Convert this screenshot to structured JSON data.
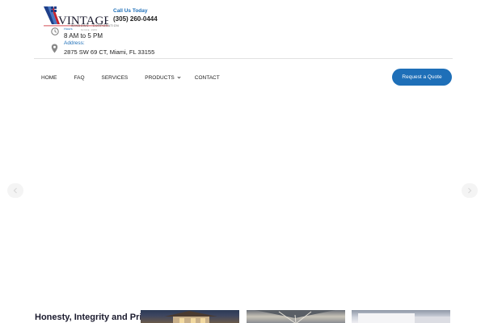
{
  "brand": {
    "logo_text": "VINTAGE",
    "logo_subtitle": "WINDOWS · CORPORATION",
    "logo_subtitle2": "SINCE 1980",
    "colors": {
      "accent": "#1e6fb8",
      "logo_red": "#c8232c",
      "logo_blue": "#1e3f8a"
    }
  },
  "contact": {
    "call_label": "Call Us Today",
    "phone": "(305) 260-0444",
    "hours_label": "Hours",
    "hours": "8 AM to 5 PM",
    "address_label": "Address:",
    "address": "2875 SW 69 CT, Miami, FL 33155"
  },
  "nav": {
    "items": [
      {
        "label": "HOME"
      },
      {
        "label": "FAQ"
      },
      {
        "label": "SERVICES"
      },
      {
        "label": "PRODUCTS",
        "has_dropdown": true
      },
      {
        "label": "CONTACT"
      }
    ],
    "quote_button": "Request a Quote"
  },
  "hero": {
    "prev_icon": "chevron-left-icon",
    "next_icon": "chevron-right-icon"
  },
  "intro": {
    "tagline": "Honesty, Integrity and Pride"
  }
}
